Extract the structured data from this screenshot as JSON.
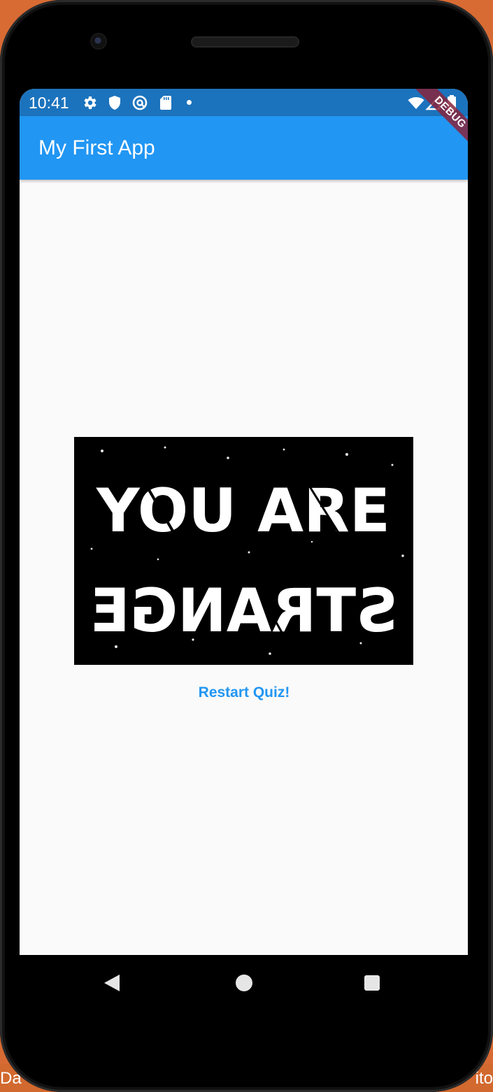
{
  "desktop": {
    "left_fragment": "Da",
    "right_fragment": "ito"
  },
  "status_bar": {
    "time": "10:41",
    "left_icons": [
      "gear-icon",
      "shield-icon",
      "at-sign-icon",
      "sd-card-icon",
      "notification-dot-icon"
    ],
    "right_icons": [
      "wifi-icon",
      "signal-icon",
      "battery-icon"
    ]
  },
  "app_bar": {
    "title": "My First App"
  },
  "debug_banner": {
    "label": "DEBUG"
  },
  "result": {
    "image_alt": "YOU ARE STRANGE",
    "image_line_1": "YOU ARE",
    "image_line_2": "STRANGE",
    "restart_label": "Restart Quiz!"
  },
  "navigation_bar": {
    "buttons": [
      "back",
      "home",
      "recents"
    ]
  },
  "colors": {
    "status_bar": "#1c73bd",
    "app_bar": "#2196f3",
    "screen_background": "#fafafa",
    "accent_text": "#2196f3",
    "debug_ribbon": "#87243c"
  }
}
